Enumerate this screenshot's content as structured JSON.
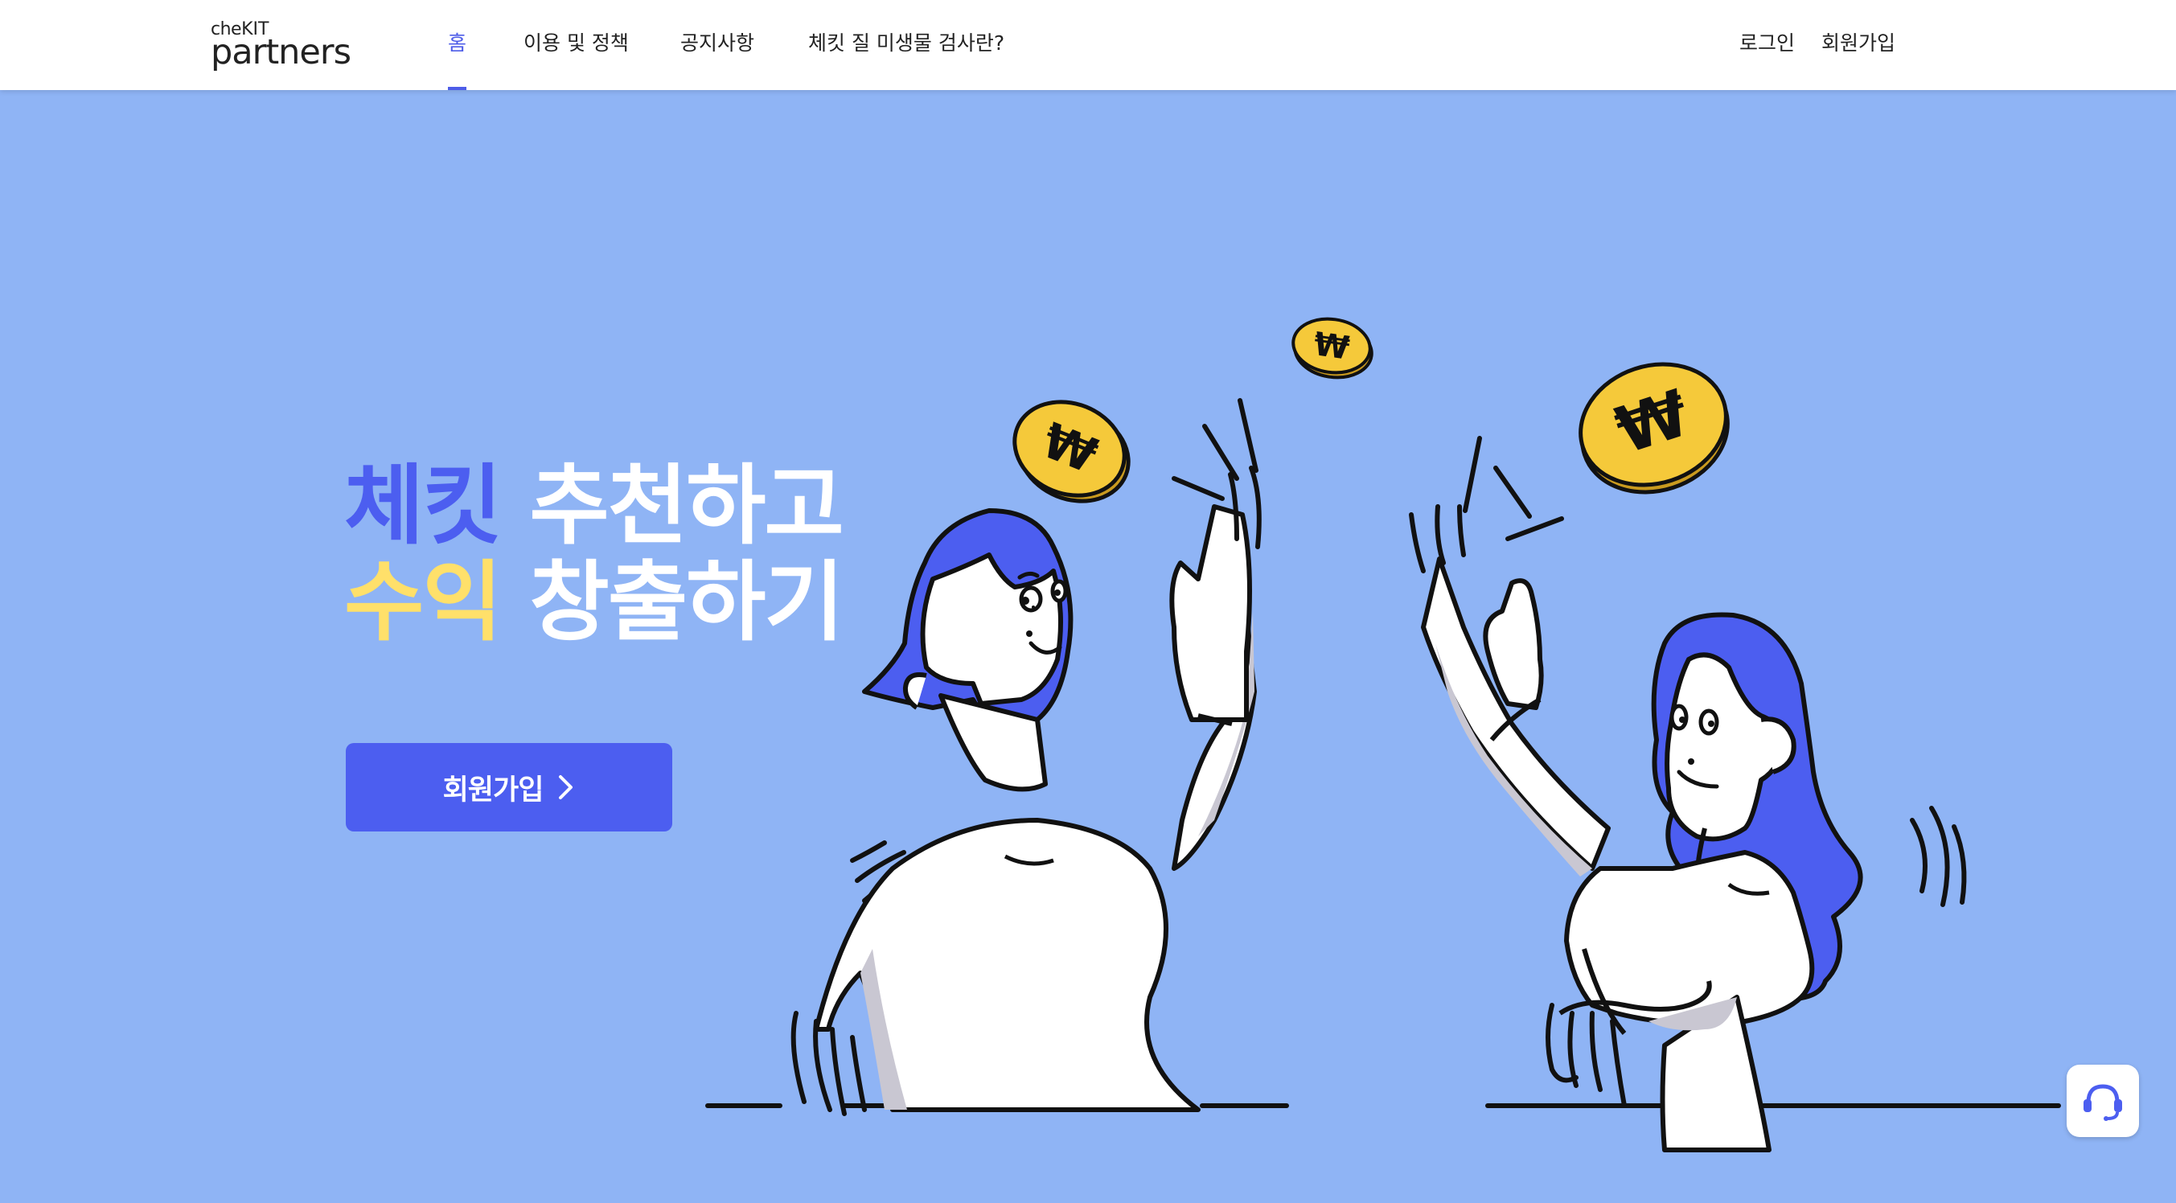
{
  "header": {
    "logo": {
      "small_prefix": "che",
      "small_accent": "KIT",
      "main": "partners"
    },
    "nav": [
      {
        "label": "홈",
        "active": true
      },
      {
        "label": "이용 및 정책"
      },
      {
        "label": "공지사항"
      },
      {
        "label": "체킷 질 미생물 검사란?"
      }
    ],
    "login_label": "로그인",
    "signup_label": "회원가입"
  },
  "hero": {
    "line1_accent": "체킷",
    "line1_rest": "추천하고",
    "line2_accent": "수익",
    "line2_rest": "창출하기",
    "cta_label": "회원가입"
  },
  "illustration": {
    "coin_symbol": "₩",
    "icons": [
      "coin-icon",
      "high-five-illustration"
    ]
  },
  "support": {
    "icon": "headset-icon"
  },
  "colors": {
    "background": "#8fb4f5",
    "accent_blue": "#4c5ef0",
    "accent_yellow": "#ffe06a",
    "nav_active": "#4d5ce8",
    "coin_gold": "#f5c93a"
  }
}
